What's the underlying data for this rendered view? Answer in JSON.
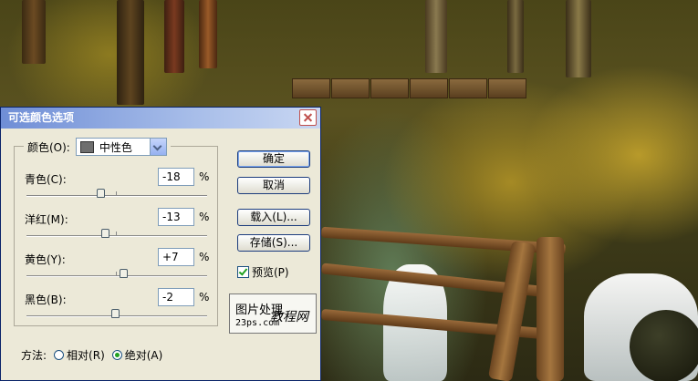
{
  "dialog": {
    "title": "可选颜色选项",
    "color_label": "颜色(O):",
    "color_value": "中性色",
    "sliders": [
      {
        "label": "青色(C):",
        "value": "-18",
        "unit": "%",
        "level": -18
      },
      {
        "label": "洋红(M):",
        "value": "-13",
        "unit": "%",
        "level": -13
      },
      {
        "label": "黄色(Y):",
        "value": "+7",
        "unit": "%",
        "level": 7
      },
      {
        "label": "黑色(B):",
        "value": "-2",
        "unit": "%",
        "level": -2
      }
    ],
    "buttons": {
      "ok": "确定",
      "cancel": "取消",
      "load": "载入(L)...",
      "save": "存储(S)..."
    },
    "preview_label": "预览(P)",
    "preview_checked": true,
    "method_label": "方法:",
    "method_options": [
      "相对(R)",
      "绝对(A)"
    ],
    "method_selected": "绝对(A)"
  },
  "watermark": {
    "line1": "图片处理",
    "line2": "23ps.com",
    "line3": "教程网"
  },
  "colors": {
    "titlebar": "#6f8ed6",
    "dialog_bg": "#ece9d8",
    "check_green": "#21a121"
  }
}
